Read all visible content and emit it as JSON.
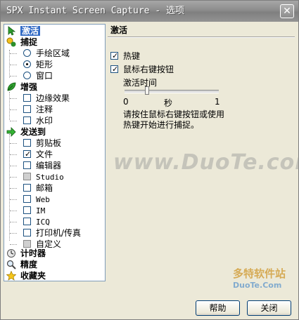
{
  "window": {
    "title": "SPX Instant Screen Capture - 选项",
    "close_glyph": "✕"
  },
  "tree": {
    "activate": "激活",
    "capture": "捕捉",
    "capture_items": [
      "手绘区域",
      "矩形",
      "窗口"
    ],
    "capture_selected": 1,
    "enhance": "增强",
    "enhance_items": [
      "边缘效果",
      "注释",
      "水印"
    ],
    "sendto": "发送到",
    "sendto_items": [
      {
        "label": "剪贴板",
        "state": "unchecked"
      },
      {
        "label": "文件",
        "state": "checked"
      },
      {
        "label": "编辑器",
        "state": "unchecked"
      },
      {
        "label": "Studio",
        "state": "gray"
      },
      {
        "label": "邮箱",
        "state": "unchecked"
      },
      {
        "label": "Web",
        "state": "unchecked"
      },
      {
        "label": "IM",
        "state": "unchecked"
      },
      {
        "label": "ICQ",
        "state": "unchecked"
      },
      {
        "label": "打印机/传真",
        "state": "unchecked"
      },
      {
        "label": "自定义",
        "state": "gray"
      }
    ],
    "timer": "计时器",
    "precision": "精度",
    "favorites": "收藏夹"
  },
  "panel": {
    "title": "激活",
    "opt_hotkey": "热键",
    "opt_rightclick": "鼠标右键按钮",
    "activation_time": "激活时间",
    "slider_min": "0",
    "slider_unit": "秒",
    "slider_max": "1",
    "slider_value": 0.25,
    "description_1": "请按住鼠标右键按钮或使用",
    "description_2": "热键开始进行捕捉。"
  },
  "buttons": {
    "help": "帮助",
    "close": "关闭"
  },
  "watermark": "www.DuoTe.com",
  "logo": {
    "line1": "多特软件站",
    "line2": "DuoTe.Com"
  },
  "colors": {
    "selection": "#316ac5",
    "tree_border": "#7f9db9"
  }
}
